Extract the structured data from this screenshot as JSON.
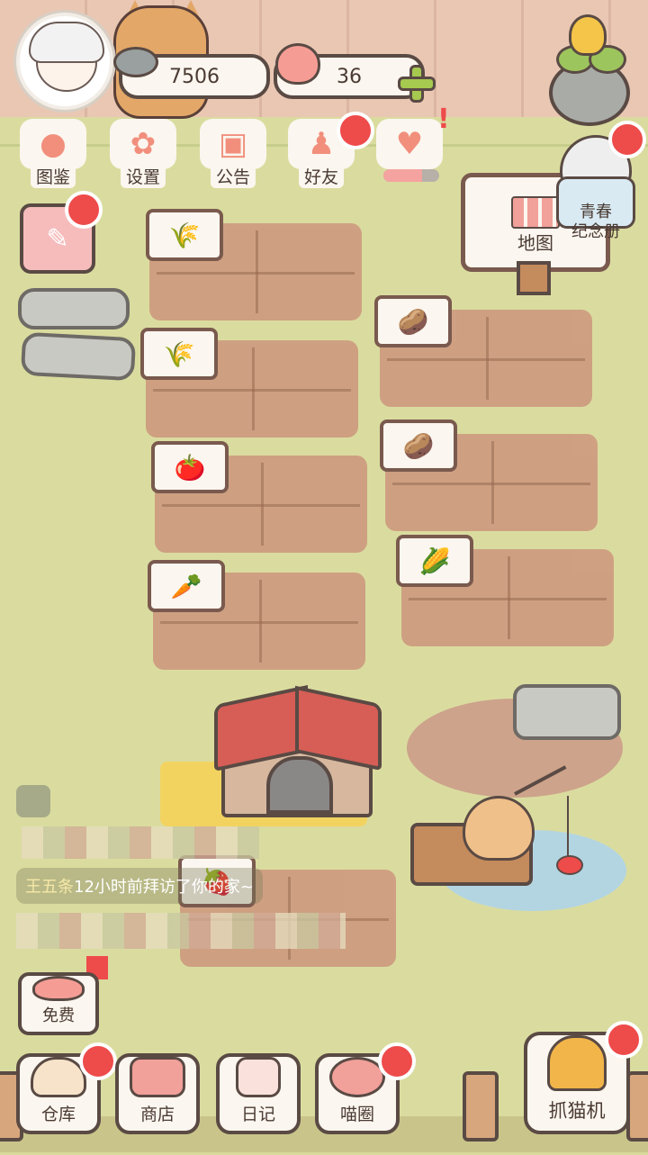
{
  "currency": {
    "fish": "7506",
    "hearts": "36"
  },
  "top_menu": {
    "collection": "图鉴",
    "settings": "设置",
    "announcement": "公告",
    "friends": "好友",
    "activity_progress": 0.7
  },
  "map_label": "地图",
  "youth_album": "青春\n纪念册",
  "visit_message": {
    "visitor": "王五条",
    "text": "12小时前拜访了你的家~"
  },
  "free_label": "免费",
  "bottom_nav": {
    "warehouse": "仓库",
    "shop": "商店",
    "diary": "日记",
    "meow_circle": "喵圈",
    "claw_machine": "抓猫机"
  },
  "crop_icons": {
    "plot1": "🌾",
    "plot2": "🌾",
    "plot3": "🍅",
    "plot4": "🥕",
    "plot5": "🥔",
    "plot6": "🥔",
    "plot7": "🌽",
    "plot8": "🍓"
  },
  "colors": {
    "accent_red": "#ee4b4b",
    "grass": "#dadc9f",
    "soil": "#cd9a7e"
  }
}
